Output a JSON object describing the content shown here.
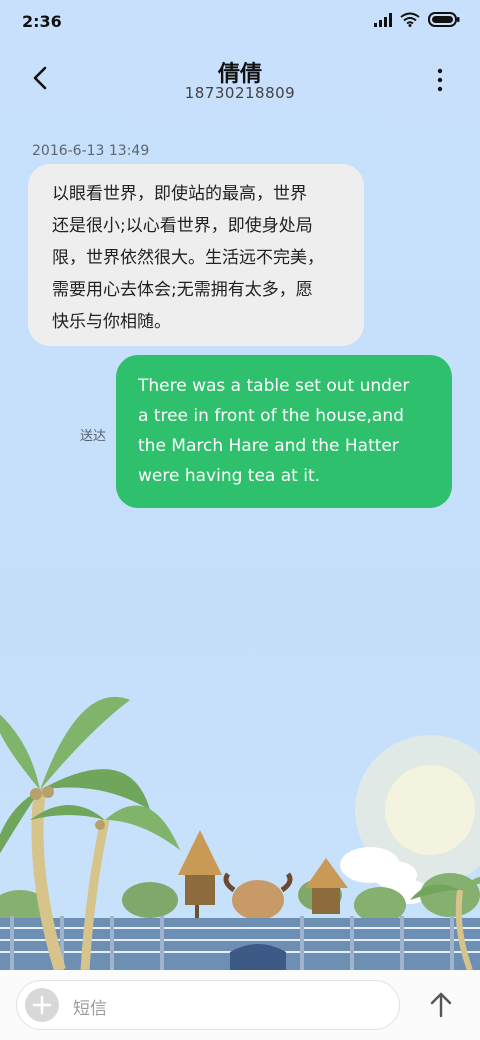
{
  "status_bar": {
    "time": "2:36"
  },
  "header": {
    "title": "倩倩",
    "phone": "18730218809"
  },
  "conversation": {
    "timestamp": "2016-6-13 13:49",
    "received_message": "以眼看世界，即使站的最高，世界\n还是很小;以心看世界，即使身处局\n限，世界依然很大。生活远不完美，\n需要用心去体会;无需拥有太多，愿\n快乐与你相随。",
    "sent_message": "There was a table set out under\na tree in front of the house,and\nthe March Hare and the Hatter\nwere having tea at it.",
    "delivery_status": "送达"
  },
  "composer": {
    "placeholder": "短信"
  },
  "colors": {
    "sent_bubble": "#2ec06c",
    "received_bubble": "#eeeeee",
    "background": "#c8e0fb"
  },
  "icons": [
    "signal-icon",
    "wifi-icon",
    "battery-icon",
    "back-arrow-icon",
    "more-vertical-icon",
    "plus-icon",
    "send-arrow-icon"
  ]
}
